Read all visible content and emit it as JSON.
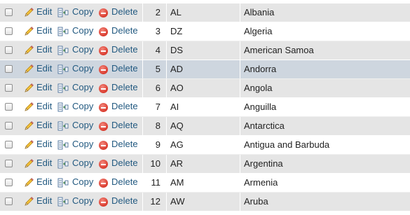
{
  "actions": {
    "edit": "Edit",
    "copy": "Copy",
    "delete": "Delete"
  },
  "rows": [
    {
      "id": "2",
      "code": "AL",
      "name": "Albania"
    },
    {
      "id": "3",
      "code": "DZ",
      "name": "Algeria"
    },
    {
      "id": "4",
      "code": "DS",
      "name": "American Samoa"
    },
    {
      "id": "5",
      "code": "AD",
      "name": "Andorra"
    },
    {
      "id": "6",
      "code": "AO",
      "name": "Angola"
    },
    {
      "id": "7",
      "code": "AI",
      "name": "Anguilla"
    },
    {
      "id": "8",
      "code": "AQ",
      "name": "Antarctica"
    },
    {
      "id": "9",
      "code": "AG",
      "name": "Antigua and Barbuda"
    },
    {
      "id": "10",
      "code": "AR",
      "name": "Argentina"
    },
    {
      "id": "11",
      "code": "AM",
      "name": "Armenia"
    },
    {
      "id": "12",
      "code": "AW",
      "name": "Aruba"
    }
  ],
  "colors": {
    "row_odd": "#e5e5e5",
    "row_even": "#ffffff",
    "row_hover": "#ced6df",
    "link": "#235a81",
    "delete_icon": "#d9392c"
  },
  "hovered_row_id": "5",
  "icons": {
    "edit": "pencil-icon",
    "copy": "copy-icon",
    "delete": "delete-icon"
  }
}
